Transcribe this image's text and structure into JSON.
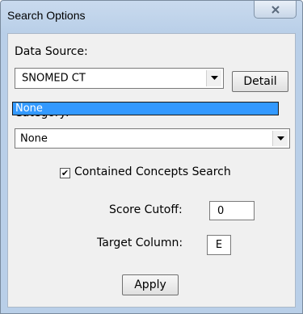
{
  "window": {
    "title": "Search Options"
  },
  "data_source": {
    "label": "Data Source:",
    "value": "SNOMED CT",
    "detail_button": "Detail"
  },
  "category": {
    "label": "Category:",
    "value": "None",
    "options": [
      "None"
    ],
    "highlighted_option": "None"
  },
  "contained_search": {
    "label": "Contained Concepts Search",
    "checked": true
  },
  "score_cutoff": {
    "label": "Score Cutoff:",
    "value": "0"
  },
  "target_column": {
    "label": "Target Column:",
    "value": "E"
  },
  "apply_button": "Apply",
  "colors": {
    "selection": "#3399ff",
    "titlebar": "#b9cfe8"
  }
}
